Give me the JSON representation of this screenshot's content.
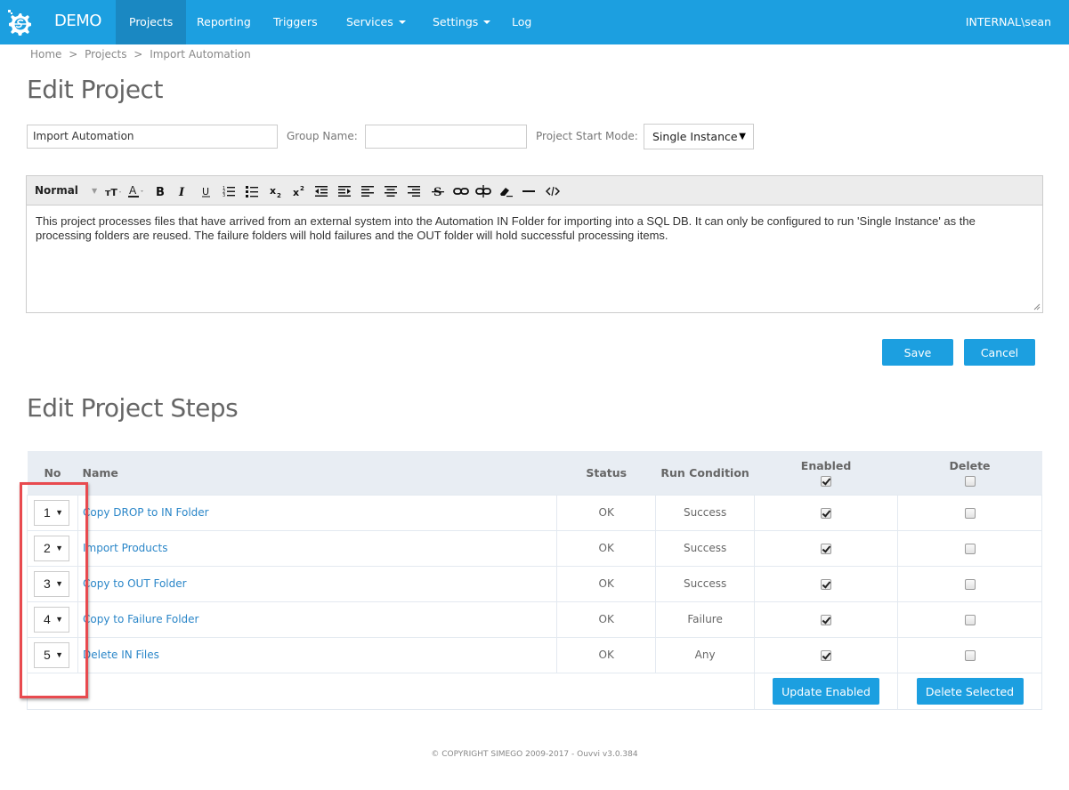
{
  "navbar": {
    "brand": "DEMO",
    "brand_icon": "gear-s-logo-icon",
    "items": [
      {
        "label": "Projects",
        "active": true,
        "dropdown": false
      },
      {
        "label": "Reporting",
        "active": false,
        "dropdown": false
      },
      {
        "label": "Triggers",
        "active": false,
        "dropdown": false
      },
      {
        "label": "Services",
        "active": false,
        "dropdown": true
      },
      {
        "label": "Settings",
        "active": false,
        "dropdown": true
      },
      {
        "label": "Log",
        "active": false,
        "dropdown": false
      }
    ],
    "user": "INTERNAL\\sean",
    "color": "#1c9fe0",
    "active_color": "#1a88c2"
  },
  "breadcrumb": [
    "Home",
    ">",
    "Projects",
    ">",
    "Import Automation"
  ],
  "page_title": "Edit Project",
  "form": {
    "project_name": "Import Automation",
    "group_name_label": "Group Name:",
    "group_name_value": "",
    "start_mode_label": "Project Start Mode:",
    "start_mode_value": "Single Instance"
  },
  "editor": {
    "style_select": "Normal",
    "toolbar_icons": [
      "font-size-icon",
      "font-color-icon",
      "bold-icon",
      "italic-icon",
      "underline-icon",
      "ordered-list-icon",
      "unordered-list-icon",
      "subscript-icon",
      "superscript-icon",
      "outdent-icon",
      "indent-icon",
      "align-left-icon",
      "align-center-icon",
      "align-right-icon",
      "strikethrough-icon",
      "link-icon",
      "unlink-icon",
      "clear-format-icon",
      "horizontal-rule-icon",
      "code-view-icon"
    ],
    "content": "This project processes files that have arrived from an external system into the Automation IN Folder for importing into a SQL DB. It can only be configured to run 'Single Instance' as the processing folders are reused. The failure folders will hold failures and the OUT folder will hold successful processing items."
  },
  "actions": {
    "save": "Save",
    "cancel": "Cancel"
  },
  "steps_title": "Edit Project Steps",
  "steps_table": {
    "headers": {
      "no": "No",
      "name": "Name",
      "status": "Status",
      "run_condition": "Run Condition",
      "enabled": "Enabled",
      "delete": "Delete"
    },
    "header_enabled_all": true,
    "header_delete_all": false,
    "rows": [
      {
        "no": "1",
        "name": "Copy DROP to IN Folder",
        "status": "OK",
        "run_condition": "Success",
        "enabled": true,
        "delete": false
      },
      {
        "no": "2",
        "name": "Import Products",
        "status": "OK",
        "run_condition": "Success",
        "enabled": true,
        "delete": false
      },
      {
        "no": "3",
        "name": "Copy to OUT Folder",
        "status": "OK",
        "run_condition": "Success",
        "enabled": true,
        "delete": false
      },
      {
        "no": "4",
        "name": "Copy to Failure Folder",
        "status": "OK",
        "run_condition": "Failure",
        "enabled": true,
        "delete": false
      },
      {
        "no": "5",
        "name": "Delete IN Files",
        "status": "OK",
        "run_condition": "Any",
        "enabled": true,
        "delete": false
      }
    ],
    "update_enabled": "Update Enabled",
    "delete_selected": "Delete Selected"
  },
  "annotation": {
    "color": "#e84a4f"
  },
  "footer": "© COPYRIGHT SIMEGO 2009-2017 - Ouvvi v3.0.384"
}
